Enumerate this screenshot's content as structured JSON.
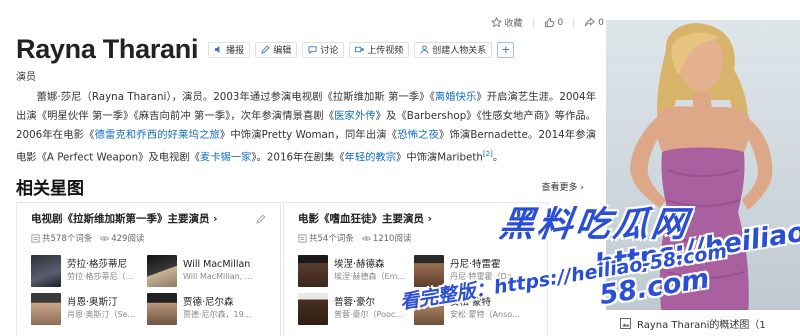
{
  "header": {
    "title": "Rayna Tharani",
    "subtitle": "演员",
    "tools": [
      {
        "label": "播报",
        "icon": "speaker-icon"
      },
      {
        "label": "编辑",
        "icon": "pencil-icon"
      },
      {
        "label": "讨论",
        "icon": "chat-icon"
      },
      {
        "label": "上传视频",
        "icon": "video-icon"
      },
      {
        "label": "创建人物关系",
        "icon": "person-icon"
      }
    ],
    "plus_label": "+",
    "actions": {
      "favorite_label": "收藏",
      "like_count": "0",
      "share_count": "0"
    }
  },
  "summary": {
    "p1": "蕾娜·莎尼（Rayna Tharani），演员。2003年通过参演电视剧《拉斯维加斯 第一季》《",
    "l1": "离婚快乐",
    "p2": "》开启演艺生涯。2004年出演《明星伙伴 第一季》《麻吉向前冲 第一季》，次年参演情景喜剧《",
    "l2": "医家外传",
    "p3": "》及《Barbershop》《性感女地产商》等作品。2006年在电影《",
    "l3": "德雷克和乔西的好莱坞之旅",
    "p4": "》中饰演Pretty Woman，同年出演《",
    "l4": "恐怖之夜",
    "p5": "》饰演Bernadette。2014年参演电影《A Perfect Weapon》及电视剧《",
    "l5": "麦卡锡一家",
    "p6": "》。2016年在剧集《",
    "l6": "年轻的教宗",
    "p7": "》中饰演Maribeth",
    "ref": "[2]",
    "p8": "。"
  },
  "related": {
    "title": "相关星图",
    "see_more": "查看更多 ›",
    "cards": [
      {
        "title": "电视剧《拉斯维加斯第一季》主要演员 ›",
        "count": "共578个词条",
        "reads": "429阅读",
        "actors": [
          {
            "name": "劳拉·格莎蒂尼",
            "role": "劳拉·格莎蒂尼（..."
          },
          {
            "name": "Will MacMillan",
            "role": "Will MacMillan, ..."
          },
          {
            "name": "肖恩·奥斯汀",
            "role": "肖恩·奥斯汀（Se..."
          },
          {
            "name": "贾德·尼尔森",
            "role": "贾德·尼尔森，19..."
          }
        ]
      },
      {
        "title": "电影《嗜血狂徒》主要演员 ›",
        "count": "共54个词条",
        "reads": "1210阅读",
        "actors": [
          {
            "name": "埃涅·赫德森",
            "role": "埃涅·赫德森（Em..."
          },
          {
            "name": "丹尼·特雷霍",
            "role": "丹尼·特雷霍（Da..."
          },
          {
            "name": "普蓉·豪尔",
            "role": "普蓉·豪尔（Pooc..."
          },
          {
            "name": "安松·蒙特",
            "role": "安松·蒙特（Anso..."
          }
        ]
      }
    ]
  },
  "photo": {
    "caption": "Rayna Tharani的概述图（1"
  },
  "watermark": {
    "line1": "黑料吃瓜网",
    "line2": "https://heiliao-58.com",
    "line3": "看完整版：https://heiliao-58.com"
  },
  "colors": {
    "link": "#136ec2",
    "dress": "#a9609f",
    "watermark": "#2a4fd6"
  }
}
